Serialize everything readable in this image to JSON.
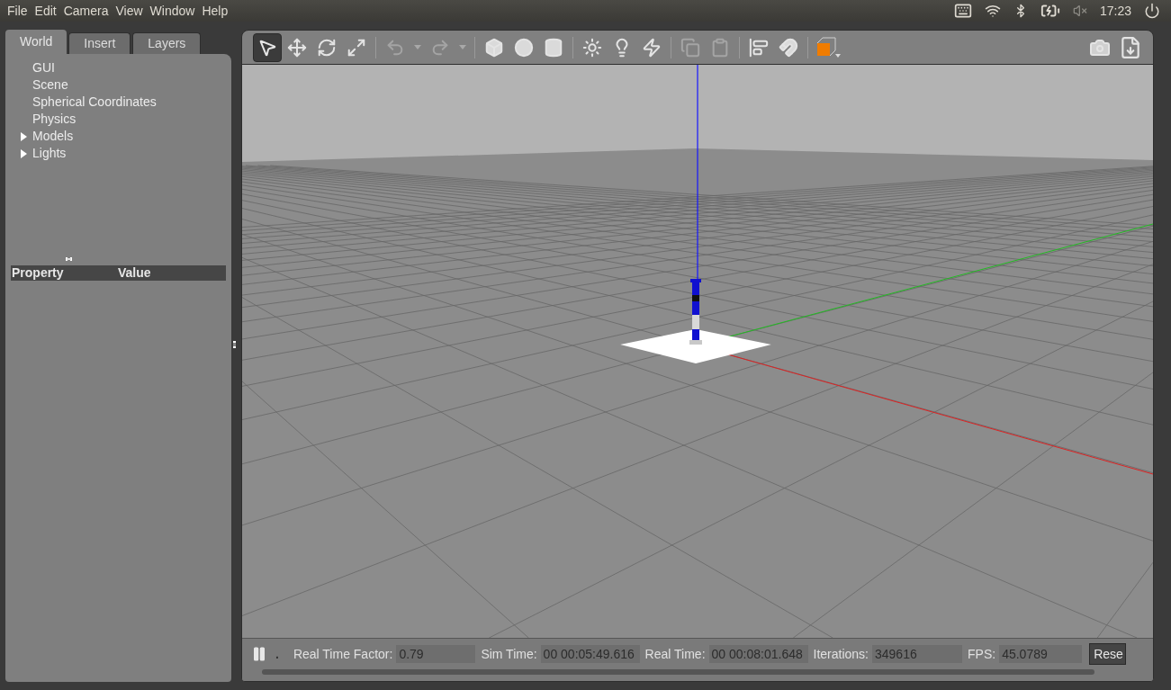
{
  "menu": [
    "File",
    "Edit",
    "Camera",
    "View",
    "Window",
    "Help"
  ],
  "tray": {
    "time": "17:23"
  },
  "tabs": [
    {
      "label": "World",
      "selected": true
    },
    {
      "label": "Insert",
      "selected": false
    },
    {
      "label": "Layers",
      "selected": false
    }
  ],
  "tree": [
    {
      "label": "GUI",
      "kind": "leaf"
    },
    {
      "label": "Scene",
      "kind": "leaf"
    },
    {
      "label": "Spherical Coordinates",
      "kind": "leaf"
    },
    {
      "label": "Physics",
      "kind": "leaf"
    },
    {
      "label": "Models",
      "kind": "group",
      "expanded": false
    },
    {
      "label": "Lights",
      "kind": "group",
      "expanded": false
    }
  ],
  "properties": {
    "columns": [
      "Property",
      "Value"
    ]
  },
  "toolbar": [
    {
      "kind": "select",
      "selected": true
    },
    {
      "kind": "translate",
      "selected": false
    },
    {
      "kind": "rotate",
      "selected": false
    },
    {
      "kind": "scale",
      "selected": false
    },
    {
      "kind": "separator"
    },
    {
      "kind": "undo"
    },
    {
      "kind": "dropdown"
    },
    {
      "kind": "redo"
    },
    {
      "kind": "dropdown"
    },
    {
      "kind": "separator"
    },
    {
      "kind": "box"
    },
    {
      "kind": "sphere"
    },
    {
      "kind": "cylinder"
    },
    {
      "kind": "separator"
    },
    {
      "kind": "point-light"
    },
    {
      "kind": "spot-light"
    },
    {
      "kind": "directional-light"
    },
    {
      "kind": "separator"
    },
    {
      "kind": "copy"
    },
    {
      "kind": "paste"
    },
    {
      "kind": "separator"
    },
    {
      "kind": "align"
    },
    {
      "kind": "magnet"
    },
    {
      "kind": "separator"
    },
    {
      "kind": "view-angle"
    }
  ],
  "status": {
    "step_mark": ".",
    "fields": [
      {
        "label": "Real Time Factor:",
        "value": "0.79"
      },
      {
        "label": "Sim Time:",
        "value": "00 00:05:49.616"
      },
      {
        "label": "Real Time:",
        "value": "00 00:08:01.648"
      },
      {
        "label": "Iterations:",
        "value": "349616"
      },
      {
        "label": "FPS:",
        "value": "45.0789"
      }
    ],
    "button": "Rese"
  }
}
